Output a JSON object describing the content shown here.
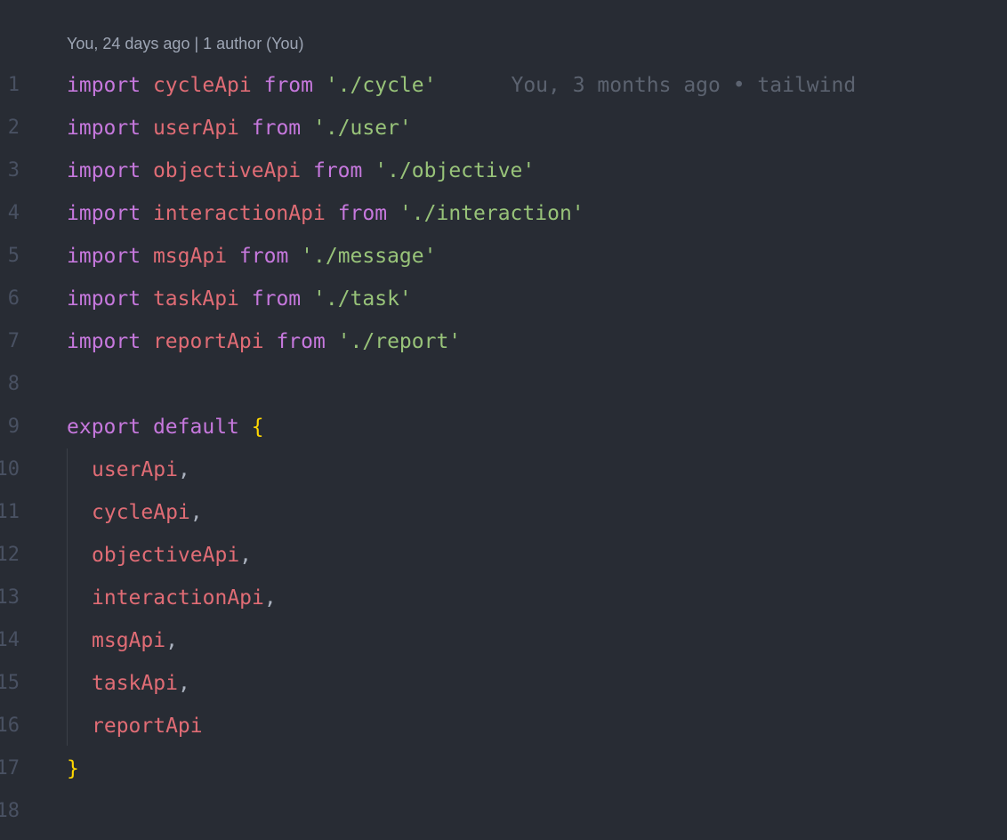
{
  "codelens": {
    "text": "You, 24 days ago | 1 author (You)"
  },
  "blame": {
    "text": "You, 3 months ago • tailwind"
  },
  "lines": [
    {
      "num": "1",
      "kw": "import",
      "id": "cycleApi",
      "from": "from",
      "str": "'./cycle'"
    },
    {
      "num": "2",
      "kw": "import",
      "id": "userApi",
      "from": "from",
      "str": "'./user'"
    },
    {
      "num": "3",
      "kw": "import",
      "id": "objectiveApi",
      "from": "from",
      "str": "'./objective'"
    },
    {
      "num": "4",
      "kw": "import",
      "id": "interactionApi",
      "from": "from",
      "str": "'./interaction'"
    },
    {
      "num": "5",
      "kw": "import",
      "id": "msgApi",
      "from": "from",
      "str": "'./message'"
    },
    {
      "num": "6",
      "kw": "import",
      "id": "taskApi",
      "from": "from",
      "str": "'./task'"
    },
    {
      "num": "7",
      "kw": "import",
      "id": "reportApi",
      "from": "from",
      "str": "'./report'"
    },
    {
      "num": "8"
    },
    {
      "num": "9",
      "kw1": "export",
      "kw2": "default",
      "brace": "{"
    },
    {
      "num": "10",
      "id": "userApi",
      "punc": ","
    },
    {
      "num": "11",
      "id": "cycleApi",
      "punc": ","
    },
    {
      "num": "12",
      "id": "objectiveApi",
      "punc": ","
    },
    {
      "num": "13",
      "id": "interactionApi",
      "punc": ","
    },
    {
      "num": "14",
      "id": "msgApi",
      "punc": ","
    },
    {
      "num": "15",
      "id": "taskApi",
      "punc": ","
    },
    {
      "num": "16",
      "id": "reportApi",
      "punc": ""
    },
    {
      "num": "17",
      "brace": "}"
    },
    {
      "num": "18"
    }
  ],
  "colors": {
    "background": "#282c34",
    "keyword": "#c678dd",
    "identifier": "#e06c75",
    "string": "#98c379",
    "brace": "#ffd700",
    "line_number": "#495162",
    "blame": "#5c6370"
  }
}
